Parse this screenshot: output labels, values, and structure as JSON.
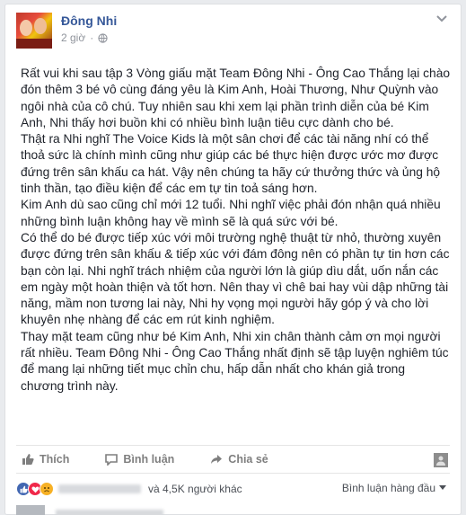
{
  "post": {
    "author": "Đông Nhi",
    "time": "2 giờ",
    "paragraphs": [
      "Rất vui khi sau tập 3 Vòng giấu mặt Team Đông Nhi - Ông Cao Thắng lại chào đón thêm 3 bé vô cùng đáng yêu là Kim Anh, Hoài Thương, Như Quỳnh vào ngôi nhà của cô chú. Tuy nhiên sau khi xem lại phần trình diễn của bé Kim Anh, Nhi thấy hơi buồn khi có nhiều bình luận tiêu cực dành cho bé.",
      "Thật ra Nhi nghĩ The Voice Kids là một sân chơi để các tài năng nhí có thể thoả sức là chính mình cũng như giúp các bé thực hiện được ước mơ được đứng trên sân khấu ca hát. Vậy nên chúng ta hãy cứ thưởng thức và ủng hộ tinh thần, tạo điều kiện để các em tự tin toả sáng hơn.",
      "Kim Anh dù sao cũng chỉ mới 12 tuổi. Nhi nghĩ việc phải đón nhận quá nhiều những bình luận không hay về mình sẽ là quá sức với bé.",
      "Có thể do bé được tiếp xúc với môi trường nghệ thuật từ nhỏ, thường xuyên được đứng trên sân khấu & tiếp xúc với đám đông nên có phần tự tin hơn các bạn còn lại. Nhi nghĩ trách nhiệm của người lớn là giúp dìu dắt, uốn nắn các em ngày một hoàn thiện và tốt hơn. Nên thay vì chê bai hay vùi dập những tài năng, mầm non tương lai này, Nhi hy vọng mọi người hãy góp ý và cho lời khuyên nhẹ nhàng để các em rút kinh nghiệm.",
      "Thay mặt team cũng như bé Kim Anh, Nhi xin chân thành cảm ơn mọi người rất nhiều. Team Đông Nhi - Ông Cao Thắng nhất định sẽ tập luyện nghiêm túc để mang lại những tiết mục chỉn chu, hấp dẫn nhất cho khán giả trong chương trình này."
    ]
  },
  "actions": {
    "like": "Thích",
    "comment": "Bình luận",
    "share": "Chia sẻ"
  },
  "reactions": {
    "count_text": "và 4,5K người khác",
    "sort_label": "Bình luận hàng đầu"
  },
  "colors": {
    "link": "#365899",
    "like": "#4267b2",
    "love": "#f0284a",
    "sad": "#f7b125"
  }
}
